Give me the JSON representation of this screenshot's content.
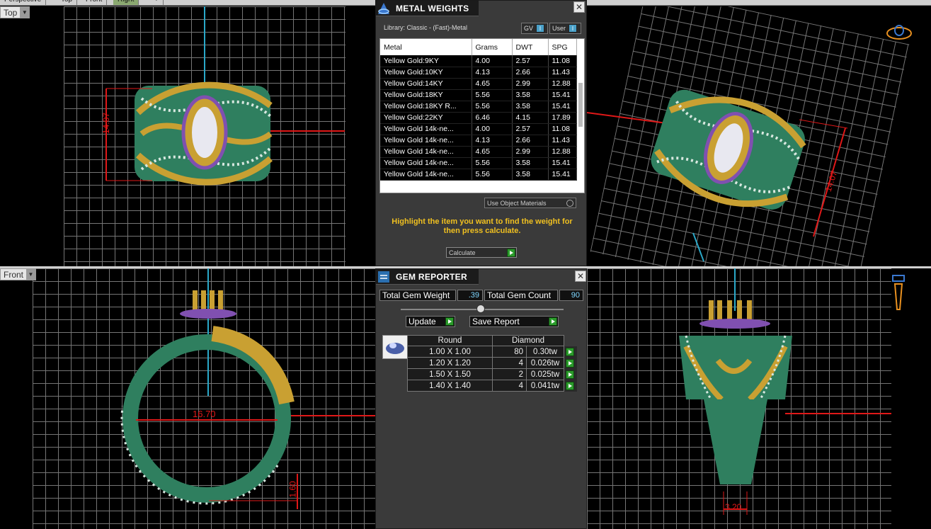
{
  "top_tabs": [
    "Perspective",
    "Top",
    "Front",
    "Right",
    "+"
  ],
  "viewports": {
    "top": {
      "label": "Top",
      "dimension": "14.07"
    },
    "front": {
      "label": "Front",
      "dimension_width": "16.70",
      "dimension_height": "1.60"
    },
    "perspective": {
      "dimension": "14.07"
    },
    "right": {
      "dimension": "3.20"
    }
  },
  "metal_weights": {
    "title": "METAL WEIGHTS",
    "library": "Library: Classic - (Fast)-Metal",
    "toggle_gv": "GV",
    "toggle_user": "User",
    "columns": [
      "Metal",
      "Grams",
      "DWT",
      "SPG"
    ],
    "rows": [
      [
        "Yellow Gold:9KY",
        "4.00",
        "2.57",
        "11.08"
      ],
      [
        "Yellow Gold:10KY",
        "4.13",
        "2.66",
        "11.43"
      ],
      [
        "Yellow Gold:14KY",
        "4.65",
        "2.99",
        "12.88"
      ],
      [
        "Yellow Gold:18KY",
        "5.56",
        "3.58",
        "15.41"
      ],
      [
        "Yellow Gold:18KY R...",
        "5.56",
        "3.58",
        "15.41"
      ],
      [
        "Yellow Gold:22KY",
        "6.46",
        "4.15",
        "17.89"
      ],
      [
        "Yellow Gold 14k-ne...",
        "4.00",
        "2.57",
        "11.08"
      ],
      [
        "Yellow Gold 14k-ne...",
        "4.13",
        "2.66",
        "11.43"
      ],
      [
        "Yellow Gold 14k-ne...",
        "4.65",
        "2.99",
        "12.88"
      ],
      [
        "Yellow Gold 14k-ne...",
        "5.56",
        "3.58",
        "15.41"
      ],
      [
        "Yellow Gold 14k-ne...",
        "5.56",
        "3.58",
        "15.41"
      ]
    ],
    "use_object_materials": "Use Object Materials",
    "hint": "Highlight the item you want to find the weight for then press calculate.",
    "calculate_label": "Calculate"
  },
  "gem_reporter": {
    "title": "GEM REPORTER",
    "total_weight_label": "Total Gem Weight",
    "total_weight_value": ".39",
    "total_count_label": "Total Gem Count",
    "total_count_value": "90",
    "update_label": "Update",
    "save_report_label": "Save Report",
    "columns": [
      "Round",
      "Diamond"
    ],
    "rows": [
      [
        "1.00 X 1.00",
        "80",
        "0.30tw"
      ],
      [
        "1.20 X 1.20",
        "4",
        "0.026tw"
      ],
      [
        "1.50 X 1.50",
        "2",
        "0.025tw"
      ],
      [
        "1.40 X 1.40",
        "4",
        "0.041tw"
      ]
    ]
  },
  "colors": {
    "ring_green": "#2f7f5f",
    "gold": "#c9a032",
    "dimension_red": "#e01818",
    "hint_yellow": "#f0c020",
    "axis_cyan": "#2aa8c8"
  },
  "icons": [
    "metal-weights-icon",
    "gem-reporter-icon",
    "close-icon",
    "navigation-ring-icon",
    "navigation-tool-icon",
    "dropdown-caret-icon"
  ]
}
